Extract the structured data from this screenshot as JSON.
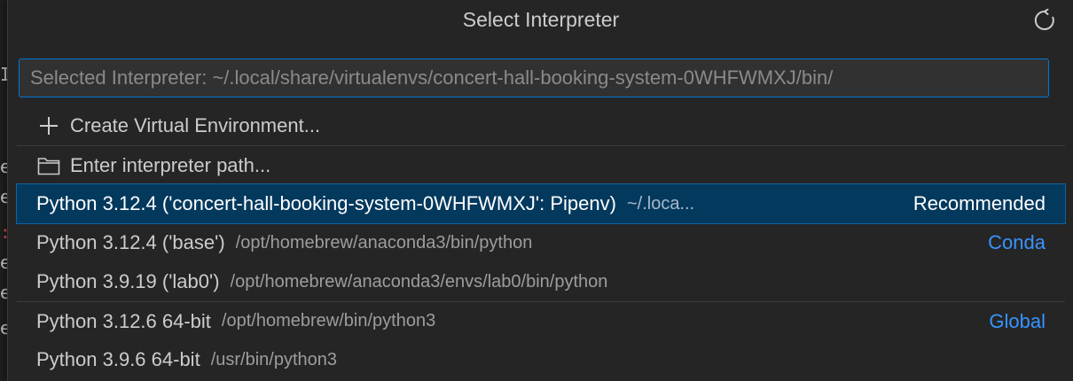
{
  "picker": {
    "title": "Select Interpreter",
    "refresh_icon": "refresh-icon",
    "input": {
      "placeholder": "Selected Interpreter: ~/.local/share/virtualenvs/concert-hall-booking-system-0WHFWMXJ/bin/",
      "value": ""
    },
    "actions": [
      {
        "label": "Create Virtual Environment...",
        "icon": "plus-icon"
      },
      {
        "label": "Enter interpreter path...",
        "icon": "folder-icon"
      }
    ],
    "interpreters": [
      {
        "label": "Python 3.12.4 ('concert-hall-booking-system-0WHFWMXJ': Pipenv)",
        "path": "~/.loca...",
        "tag": "Recommended",
        "selected": true
      },
      {
        "label": "Python 3.12.4 ('base')",
        "path": "/opt/homebrew/anaconda3/bin/python",
        "tag": "Conda"
      },
      {
        "label": "Python 3.9.19 ('lab0')",
        "path": "/opt/homebrew/anaconda3/envs/lab0/bin/python",
        "tag": ""
      },
      {
        "label": "Python 3.12.6 64-bit",
        "path": "/opt/homebrew/bin/python3",
        "tag": "Global"
      },
      {
        "label": "Python 3.9.6 64-bit",
        "path": "/usr/bin/python3",
        "tag": ""
      }
    ]
  },
  "editor_fragments": [
    "I",
    "e",
    "e",
    "e",
    "e",
    "e"
  ],
  "colors": {
    "accent": "#0078d4",
    "selection": "#04395e",
    "tag": "#3794ff"
  }
}
